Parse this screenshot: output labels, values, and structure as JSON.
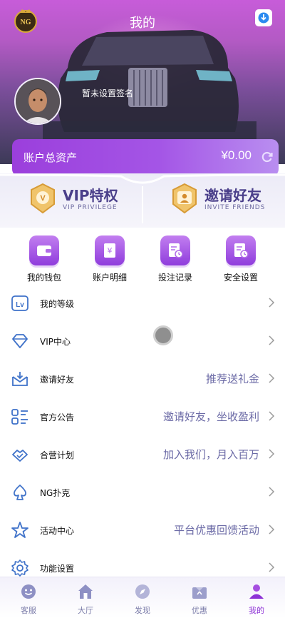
{
  "header": {
    "title": "我的",
    "logo_text": "NG"
  },
  "profile": {
    "signature": "暂未设置签名"
  },
  "assets": {
    "label": "账户总资产",
    "value": "¥0.00"
  },
  "promo": [
    {
      "title": "VIP特权",
      "subtitle": "VIP PRIVILEGE",
      "icon": "vip-medal-icon"
    },
    {
      "title": "邀请好友",
      "subtitle": "INVITE FRIENDS",
      "icon": "invite-medal-icon"
    }
  ],
  "quick_actions": [
    {
      "label": "我的钱包",
      "icon": "wallet-icon"
    },
    {
      "label": "账户明细",
      "icon": "ledger-icon"
    },
    {
      "label": "投注记录",
      "icon": "bet-record-icon"
    },
    {
      "label": "安全设置",
      "icon": "security-icon"
    }
  ],
  "menu": [
    {
      "label": "我的等级",
      "value": "",
      "icon": "level-icon"
    },
    {
      "label": "VIP中心",
      "value": "",
      "icon": "diamond-icon"
    },
    {
      "label": "邀请好友",
      "value": "推荐送礼金",
      "icon": "invite-icon"
    },
    {
      "label": "官方公告",
      "value": "邀请好友，坐收盈利",
      "icon": "announcement-icon"
    },
    {
      "label": "合营计划",
      "value": "加入我们，月入百万",
      "icon": "partner-icon"
    },
    {
      "label": "NG扑克",
      "value": "",
      "icon": "spade-icon"
    },
    {
      "label": "活动中心",
      "value": "平台优惠回馈活动",
      "icon": "star-icon"
    },
    {
      "label": "功能设置",
      "value": "",
      "icon": "settings-icon"
    }
  ],
  "tabs": [
    {
      "label": "客服",
      "icon": "customer-service-icon",
      "active": false
    },
    {
      "label": "大厅",
      "icon": "home-icon",
      "active": false
    },
    {
      "label": "发现",
      "icon": "compass-icon",
      "active": false
    },
    {
      "label": "优惠",
      "icon": "gift-icon",
      "active": false
    },
    {
      "label": "我的",
      "icon": "user-icon",
      "active": true
    }
  ],
  "colors": {
    "accent": "#8e33d6",
    "menu_value": "#6b6aa6",
    "tab_inactive": "#7b7ca9"
  }
}
